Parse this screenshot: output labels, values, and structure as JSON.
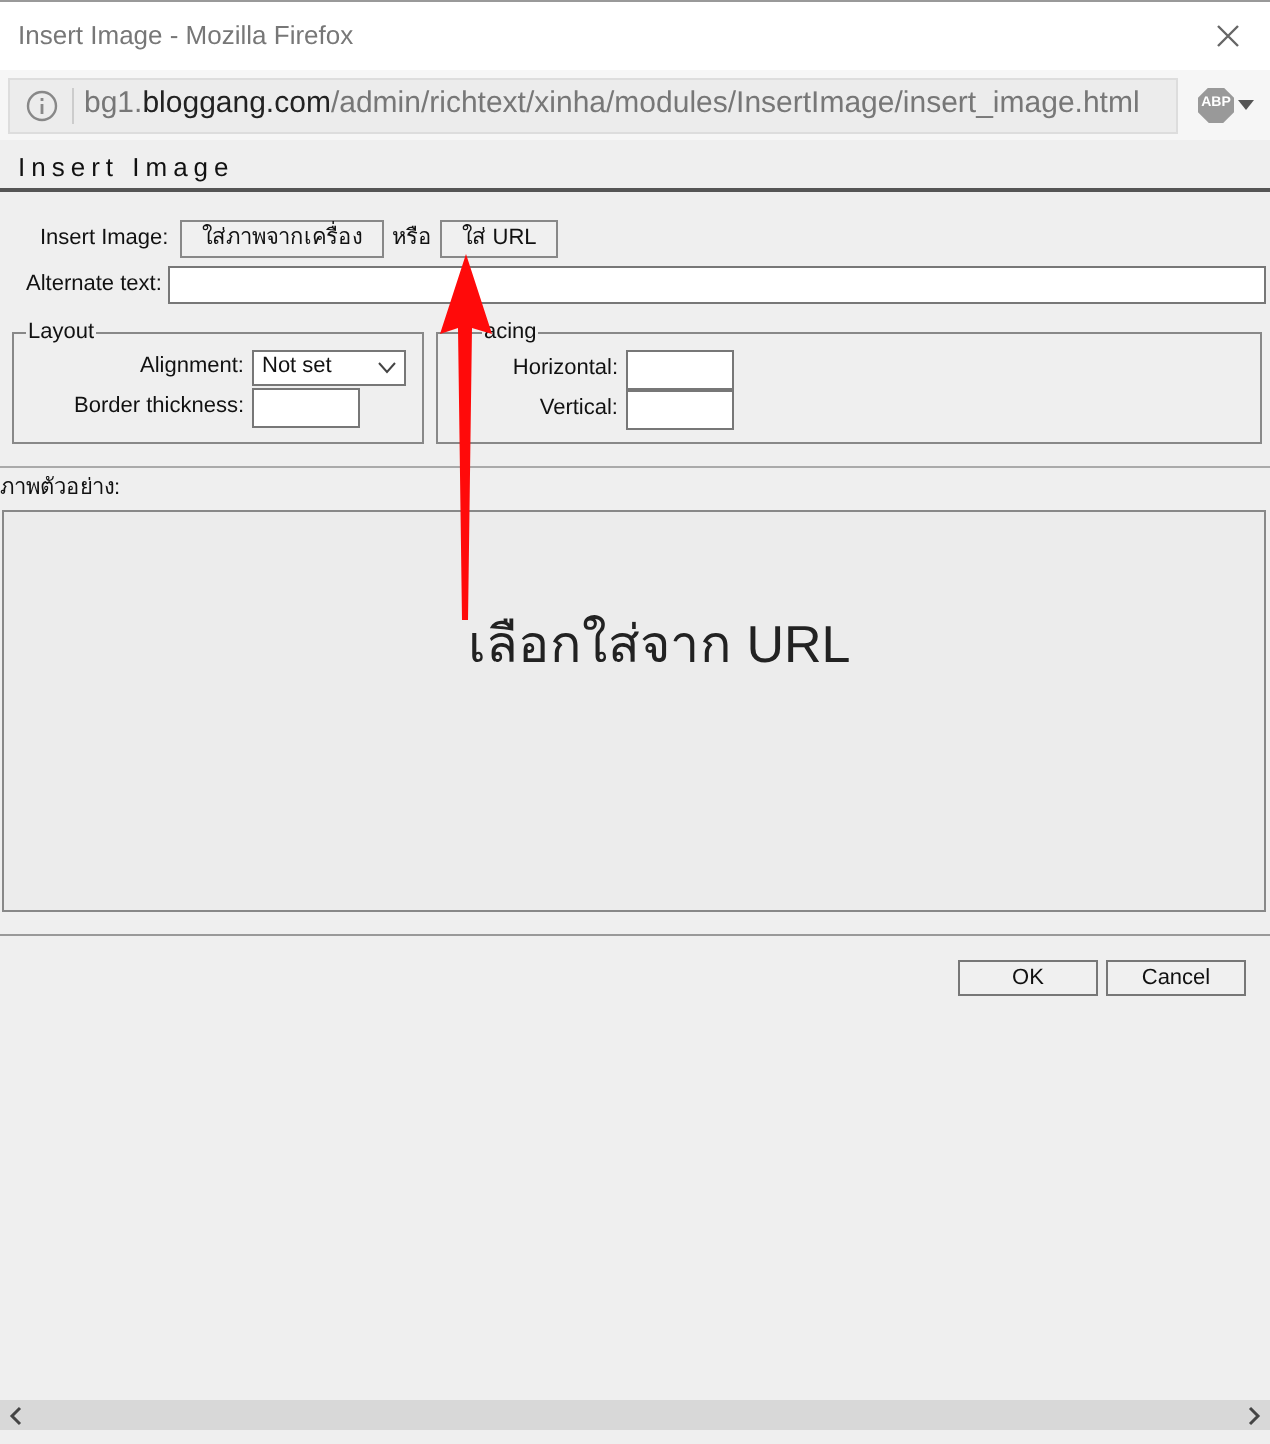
{
  "window": {
    "title": "Insert Image - Mozilla Firefox"
  },
  "address_bar": {
    "host_prefix": "bg1.",
    "host": "bloggang.com",
    "path": "/admin/richtext/xinha/modules/InsertImage/insert_image.html",
    "extension_badge": "ABP"
  },
  "dialog": {
    "title": "Insert Image",
    "insert_label": "Insert Image:",
    "upload_button": "ใส่ภาพจากเครื่อง",
    "or_text": "หรือ",
    "url_button": "ใส่ URL",
    "alt_label": "Alternate text:",
    "layout": {
      "legend": "Layout",
      "alignment_label": "Alignment:",
      "alignment_value": "Not set",
      "border_label": "Border thickness:"
    },
    "spacing": {
      "legend": "acing",
      "horizontal_label": "Horizontal:",
      "vertical_label": "Vertical:"
    },
    "preview_label": "ภาพตัวอย่าง:",
    "buttons": [
      "OK",
      "Cancel"
    ]
  },
  "annotation": {
    "text": "เลือกใส่จาก URL"
  }
}
